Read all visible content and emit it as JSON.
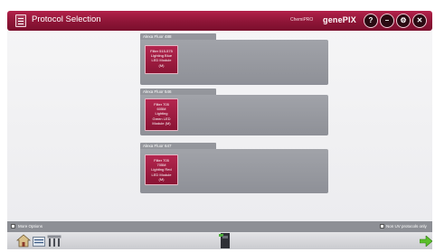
{
  "window": {
    "title": "Protocol Selection",
    "brand_small": "ChemiPRO",
    "brand": "genePIX",
    "controls": [
      {
        "name": "help-button",
        "glyph": "?"
      },
      {
        "name": "minimize-button",
        "glyph": "–"
      },
      {
        "name": "settings-button",
        "glyph": "⚙"
      },
      {
        "name": "close-button",
        "glyph": "✕"
      }
    ]
  },
  "panels": [
    {
      "name": "Alexa Fluor 488",
      "protocol": "Filter 515-575\nLighting Blue\nLED Module\n(M)"
    },
    {
      "name": "Alexa Fluor 546",
      "protocol": "Filter 705\n605M\nLighting\nGreen LED\nModule (M)"
    },
    {
      "name": "Alexa Fluor 647",
      "protocol": "Filter 705\n705M\nLighting Red\nLED Module\n(M)"
    }
  ],
  "options": {
    "more_options": "More Options",
    "non_uv_only": "Non UV protocols only"
  },
  "toolbar": {
    "home_icon": "home-icon",
    "gel_icon": "gel-icon",
    "rack_icon": "rack-icon",
    "camera_icon": "camera-icon",
    "next_icon": "next-arrow-icon"
  },
  "colors": {
    "accent": "#8e1537",
    "panel": "#9a9ca2",
    "next": "#5bbf2a"
  }
}
